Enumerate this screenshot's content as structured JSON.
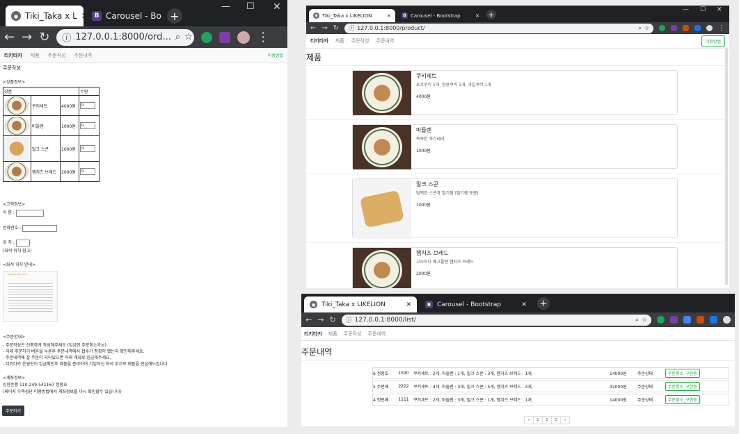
{
  "window_order": {
    "tab1_title": "Tiki_Taka x L",
    "tab2_title": "Carousel - Bo",
    "url": "127.0.0.1:8000/ord...",
    "site_nav": [
      "티키타카",
      "제품",
      "주문작성",
      "주문내역"
    ],
    "help_label": "이용방법",
    "page_title": "주문작성",
    "product_section": "<상품정보>",
    "col_product": "상품",
    "col_qty": "수량",
    "products": [
      {
        "name": "쿠키세트",
        "price": "4000원",
        "qty": "0"
      },
      {
        "name": "마들렌",
        "price": "1000원",
        "qty": "0"
      },
      {
        "name": "밀크 스콘",
        "price": "1000원",
        "qty": "0"
      },
      {
        "name": "햄치즈 브레드",
        "price": "2000원",
        "qty": "0"
      }
    ],
    "customer_section": "<고객정보>",
    "name_label": "이 름 :",
    "phone_label": "전화번호 :",
    "location_label": "위 치 :",
    "location_hint": "(좌석 위치 참고)",
    "seat_section": "<좌석 위치 안내>",
    "seat_map_caption": "TIKITAKA SEAT MAP",
    "notice_section": "<주문안내>",
    "notice_lines": [
      "- 주문작성은 신중하게 작성해주세요 (입금전 주문취소가능)",
      "- 아래 주문하기 버튼을 누른후 주문내역에서 접수가 정확히 됐는지 확인해주세요.",
      "- 주문내역에 잘 주문이 되어있으면 아래 계좌로 입금해주세요.",
      "- 티키타카 운영진이 입금확인후 제품을 준비하여 기입하신 좌석 위치로 제품을 전달해드립니다."
    ],
    "account_section": "<계좌정보>",
    "account_lines": [
      "신한은행 110-249-541167 정종호",
      "(페이지 우측상단 이용방법에서 계좌정보를 다시 확인할수 있습니다)"
    ],
    "order_button": "주문하기"
  },
  "window_product": {
    "tab1_title": "Tiki_Taka x LIKELION",
    "tab2_title": "Carousel - Bootstrap",
    "url": "127.0.0.1:8000/product/",
    "site_nav": [
      "티키타카",
      "제품",
      "주문작성",
      "주문내역"
    ],
    "help_label": "이용방법",
    "page_title": "제품",
    "products": [
      {
        "name": "쿠키세트",
        "desc": "초코쿠키 1개, 땅콩쿠키 1개, 과일쿠키 1개",
        "price": "4000원"
      },
      {
        "name": "마들렌",
        "desc": "촉촉한 카스테라",
        "price": "1000원"
      },
      {
        "name": "밀크 스콘",
        "desc": "담백한 스콘과 딸기잼 (딸기잼 동봉)",
        "price": "1000원"
      },
      {
        "name": "햄치즈 브레드",
        "desc": "고소하다 베고플땐 햄치즈 브레드",
        "price": "2000원"
      }
    ]
  },
  "window_list": {
    "tab1_title": "Tiki_Taka x LIKELION",
    "tab2_title": "Carousel - Bootstrap",
    "url": "127.0.0.1:8000/list/",
    "site_nav": [
      "티키타카",
      "제품",
      "주문작성",
      "주문내역"
    ],
    "page_title": "주문내역",
    "orders": [
      {
        "id": "6",
        "name": "정종호",
        "code": "1590",
        "items": "쿠키세트 : 2개, 마들렌 : 1개, 밀크 스콘 : 3개, 햄치즈 브레드 : 1개,",
        "total": "14000원",
        "status": "주문상태",
        "action": "주문취소_구현중"
      },
      {
        "id": "5",
        "name": "주번째",
        "code": "2222",
        "items": "쿠키세트 : 4개, 마들렌 : 3개, 밀크 스콘 : 5개, 햄치즈 브레드 : 4개,",
        "total": "32000원",
        "status": "주문상태",
        "action": "주문취소_구현중"
      },
      {
        "id": "4",
        "name": "첫번째",
        "code": "1111",
        "items": "쿠키세트 : 2개, 마들렌 : 3개, 밀크 스콘 : 1개, 햄치즈 브레드 : 1개,",
        "total": "14000원",
        "status": "주문상태",
        "action": "주문취소_구현중"
      }
    ],
    "pagination": [
      "«",
      "1",
      "2",
      "3",
      "»"
    ]
  }
}
